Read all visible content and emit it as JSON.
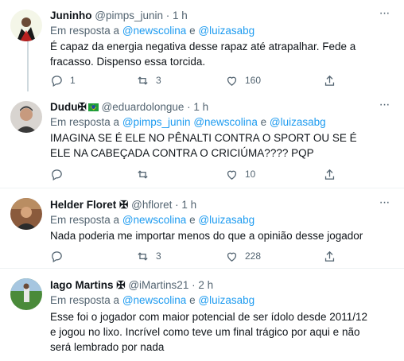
{
  "tweets": [
    {
      "name": "Juninho",
      "handle": "@pimps_junin",
      "dot": "·",
      "time": "1 h",
      "more": "···",
      "reply_prefix": "Em resposta a",
      "reply_links": [
        "@newscolina",
        "@luizasabg"
      ],
      "reply_sep": "e",
      "text": "É capaz da energia negativa desse rapaz até atrapalhar. Fede a fracasso. Dispenso essa torcida.",
      "replies": "1",
      "retweets": "3",
      "likes": "160",
      "avatar_colors": [
        "#f4f6e8",
        "#1a1a1a"
      ]
    },
    {
      "name": "Dudu✠",
      "handle": "@eduardolongue",
      "dot": "·",
      "time": "1 h",
      "more": "···",
      "reply_prefix": "Em resposta a",
      "reply_links": [
        "@pimps_junin",
        "@newscolina",
        "@luizasabg"
      ],
      "reply_sep": "e",
      "text": "IMAGINA SE É ELE NO PÊNALTI CONTRA O SPORT OU SE É ELE NA CABEÇADA CONTRA O CRICIÚMA???? PQP",
      "replies": "",
      "retweets": "",
      "likes": "10",
      "avatar_colors": [
        "#d8d4d0",
        "#3a3a3a"
      ]
    },
    {
      "name": "Helder Floret ✠",
      "handle": "@hfloret",
      "dot": "·",
      "time": "1 h",
      "more": "···",
      "reply_prefix": "Em resposta a",
      "reply_links": [
        "@newscolina",
        "@luizasabg"
      ],
      "reply_sep": "e",
      "text": "Nada poderia me importar menos do que a opinião desse jogador",
      "replies": "",
      "retweets": "3",
      "likes": "228",
      "avatar_colors": [
        "#8a5a3c",
        "#2b2b2b"
      ]
    },
    {
      "name": "Iago Martins ✠",
      "handle": "@iMartins21",
      "dot": "·",
      "time": "2 h",
      "more": "",
      "reply_prefix": "Em resposta a",
      "reply_links": [
        "@newscolina",
        "@luizasabg"
      ],
      "reply_sep": "e",
      "text": "Esse foi o jogador com maior potencial de ser ídolo desde 2011/12 e jogou no lixo. Incrível como teve um final trágico por aqui e não será lembrado por nada",
      "avatar_colors": [
        "#4a8a3a",
        "#e8e8e8"
      ]
    }
  ],
  "colors": {
    "link": "#1d9bf0",
    "muted": "#536471",
    "text": "#0f1419",
    "divider": "#eff3f4",
    "thread": "#cfd9de"
  }
}
